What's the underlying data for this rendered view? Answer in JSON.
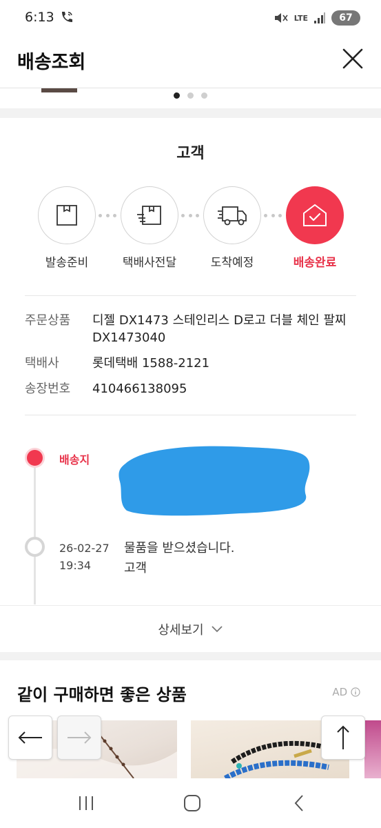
{
  "status_bar": {
    "time": "6:13",
    "network": "LTE",
    "battery": "67",
    "icons": [
      "wifi-call-icon",
      "mute-icon",
      "signal-icon"
    ]
  },
  "header": {
    "title": "배송조회",
    "close_icon": "close-icon"
  },
  "carousel": {
    "dots": 3,
    "active_index": 0
  },
  "delivery": {
    "recipient": "고객",
    "steps": [
      {
        "label": "발송준비",
        "icon": "box-icon",
        "done": false
      },
      {
        "label": "택배사전달",
        "icon": "handover-box-icon",
        "done": false
      },
      {
        "label": "도착예정",
        "icon": "truck-icon",
        "done": false
      },
      {
        "label": "배송완료",
        "icon": "house-check-icon",
        "done": true
      }
    ],
    "info": [
      {
        "key": "주문상품",
        "value": "디젤 DX1473 스테인리스 D로고 더블 체인 팔찌 DX1473040"
      },
      {
        "key": "택배사",
        "value": "롯데택배 1588-2121"
      },
      {
        "key": "송장번호",
        "value": "410466138095"
      }
    ],
    "timeline": {
      "destination_label": "배송지",
      "events": [
        {
          "date": "26-02-27",
          "time": "19:34",
          "message": "물품을 받으셨습니다.",
          "actor": "고객"
        }
      ]
    },
    "more_label": "상세보기"
  },
  "recommendations": {
    "title": "같이 구매하면 좋은 상품",
    "ad_label": "AD"
  },
  "colors": {
    "accent": "#f1384f",
    "accent_text": "#e8334a",
    "redaction": "#2f9be8"
  }
}
